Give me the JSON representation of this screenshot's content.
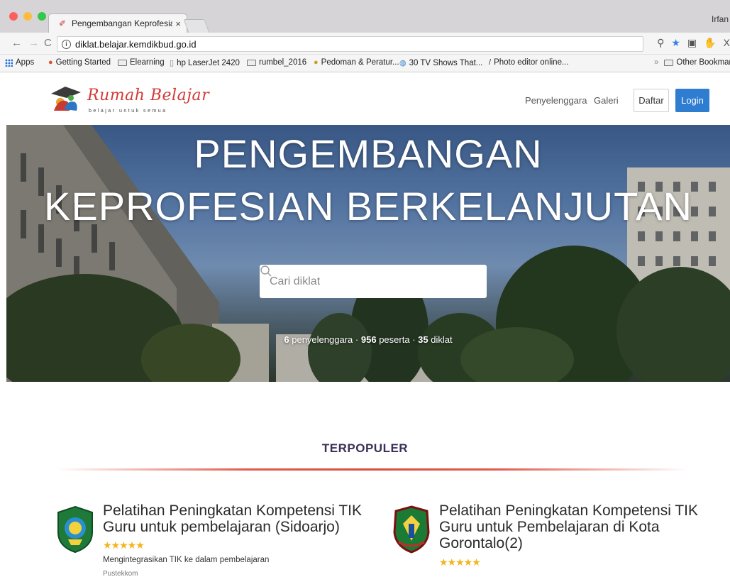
{
  "browser": {
    "tab_title": "Pengembangan Keprofesian Be",
    "tab_close": "×",
    "profile": "Irfan",
    "url": "diklat.belajar.kemdikbud.go.id",
    "bookmarks": {
      "apps": "Apps",
      "items": [
        "Getting Started",
        "Elearning",
        "hp LaserJet 2420",
        "rumbel_2016",
        "Pedoman & Peratur...",
        "30 TV Shows That...",
        "Photo editor online..."
      ],
      "overflow": "»",
      "other": "Other Bookmarks"
    }
  },
  "site": {
    "logo_title": "Rumah Belajar",
    "logo_tagline": "belajar untuk semua",
    "nav": {
      "penyelenggara": "Penyelenggara",
      "galeri": "Galeri",
      "daftar": "Daftar",
      "login": "Login"
    }
  },
  "hero": {
    "title_line1": "PENGEMBANGAN",
    "title_line2": "KEPROFESIAN BERKELANJUTAN",
    "search_placeholder": "Cari diklat",
    "stats": {
      "penyelenggara_count": "6",
      "penyelenggara_label": "penyelenggara",
      "peserta_count": "956",
      "peserta_label": "peserta",
      "diklat_count": "35",
      "diklat_label": "diklat",
      "separator": "·"
    }
  },
  "popular": {
    "heading": "TERPOPULER",
    "cards": [
      {
        "title": "Pelatihan Peningkatan Kompetensi TIK Guru untuk pembelajaran (Sidoarjo)",
        "rating": 5,
        "stars": "★★★★★",
        "description": "Mengintegrasikan TIK ke dalam pembelajaran",
        "subtext": "Pustekkom"
      },
      {
        "title": "Pelatihan Peningkatan Kompetensi TIK Guru untuk Pembelajaran di Kota Gorontalo(2)",
        "rating": 5,
        "stars": "★★★★★"
      }
    ]
  },
  "colors": {
    "accent_blue": "#2e7dd1",
    "brand_red": "#d23a35",
    "star": "#f3b51b",
    "rule": "#d94c3e"
  }
}
